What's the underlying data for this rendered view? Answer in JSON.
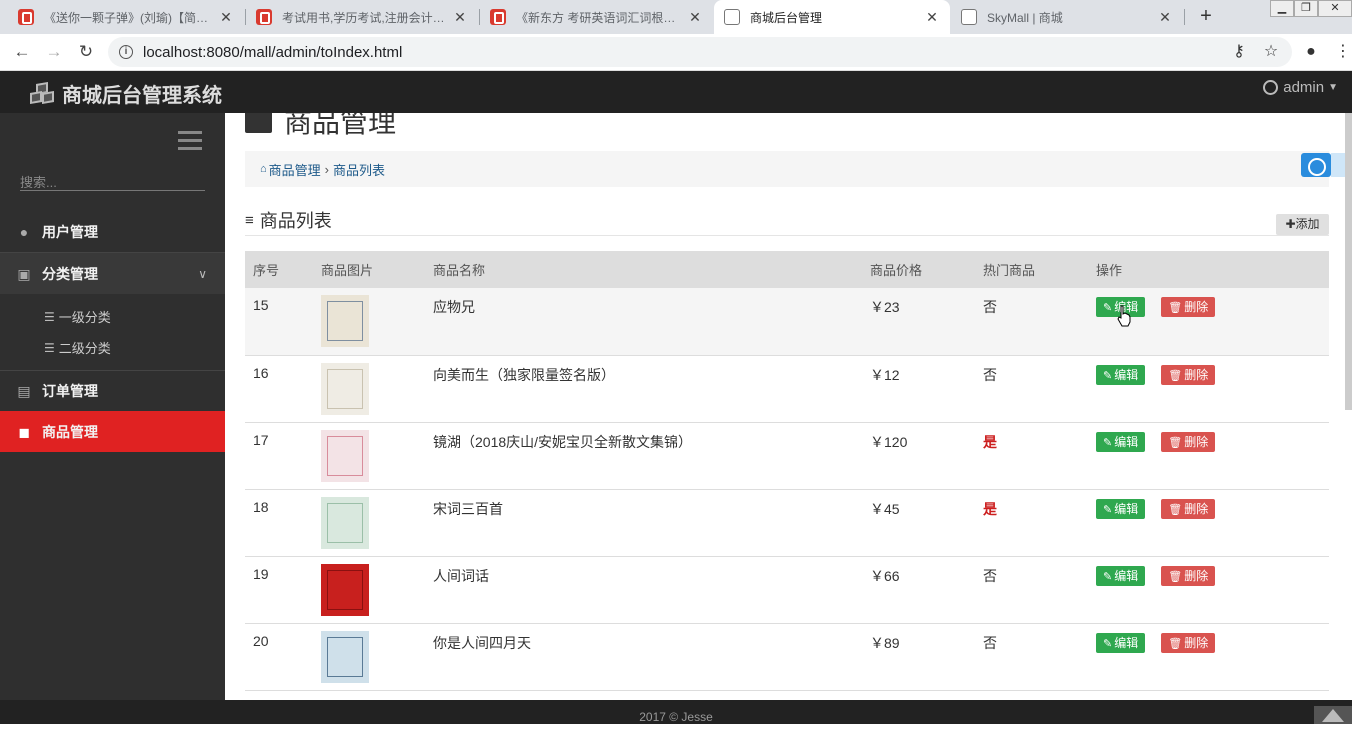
{
  "browser": {
    "tabs": [
      {
        "title": "《送你一颗子弹》(刘瑜)【简介_",
        "icon": "bookstore-favicon"
      },
      {
        "title": "考试用书,学历考试,注册会计师,公",
        "icon": "bookstore-favicon"
      },
      {
        "title": "《新东方 考研英语词汇词根+联",
        "icon": "bookstore-favicon"
      },
      {
        "title": "商城后台管理",
        "icon": "page-favicon",
        "active": true
      },
      {
        "title": "SkyMall | 商城",
        "icon": "page-favicon"
      }
    ],
    "url": "localhost:8080/mall/admin/toIndex.html"
  },
  "app": {
    "brand": "商城后台管理系统",
    "user": "admin",
    "footer": "2017 © Jesse"
  },
  "sidebar": {
    "search_placeholder": "搜索...",
    "items": [
      {
        "label": "用户管理",
        "icon": "user-circle-icon"
      },
      {
        "label": "分类管理",
        "icon": "category-icon",
        "expanded": true
      },
      {
        "label": "订单管理",
        "icon": "file-icon"
      },
      {
        "label": "商品管理",
        "icon": "shopping-bag-icon",
        "active": true
      }
    ],
    "subitems": [
      {
        "label": "一级分类",
        "icon": "list-icon"
      },
      {
        "label": "二级分类",
        "icon": "list-icon"
      }
    ]
  },
  "main": {
    "page_title": "商品管理",
    "breadcrumb": {
      "home": "商品管理",
      "current": "商品列表"
    },
    "section_title": "商品列表",
    "add_label": "添加",
    "columns": [
      "序号",
      "商品图片",
      "商品名称",
      "商品价格",
      "热门商品",
      "操作"
    ],
    "rows": [
      {
        "id": "15",
        "name": "应物兄",
        "price": "￥23",
        "hot": "否"
      },
      {
        "id": "16",
        "name": "向美而生（独家限量签名版）",
        "price": "￥12",
        "hot": "否"
      },
      {
        "id": "17",
        "name": "镜湖（2018庆山/安妮宝贝全新散文集锦）",
        "price": "￥120",
        "hot": "是"
      },
      {
        "id": "18",
        "name": "宋词三百首",
        "price": "￥45",
        "hot": "是"
      },
      {
        "id": "19",
        "name": "人间词话",
        "price": "￥66",
        "hot": "否"
      },
      {
        "id": "20",
        "name": "你是人间四月天",
        "price": "￥89",
        "hot": "否"
      }
    ],
    "edit_label": "编辑",
    "delete_label": "删除"
  },
  "colors": {
    "sidebar_active": "#e02222",
    "edit_button": "#2fa84f",
    "delete_button": "#d9534f",
    "hot_yes": "#cc1f1f"
  }
}
